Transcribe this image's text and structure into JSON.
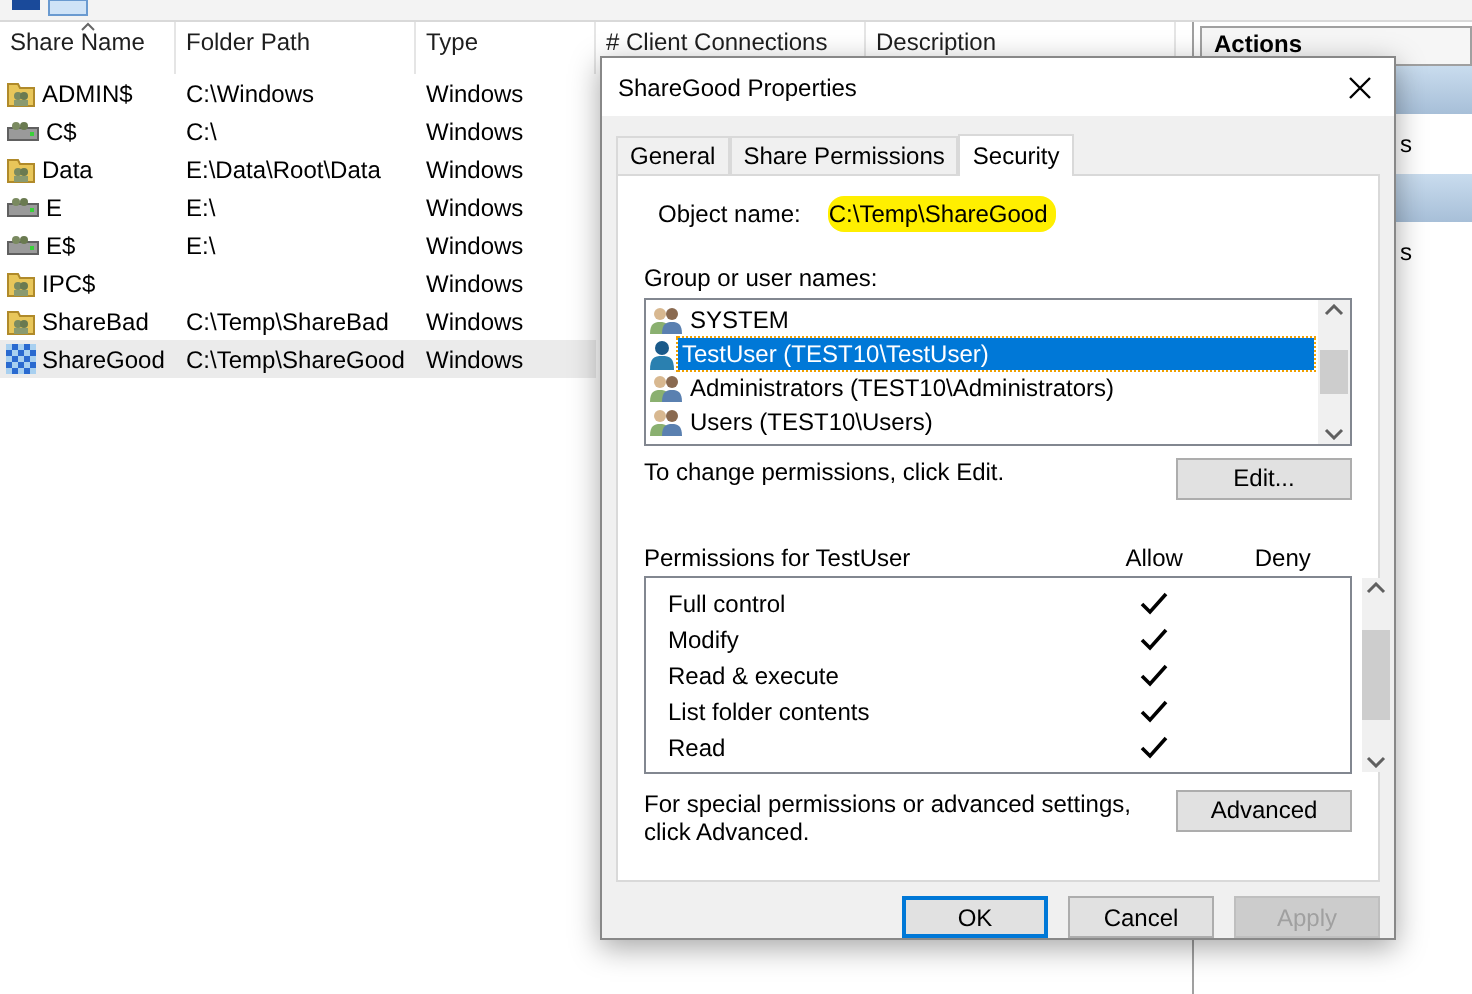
{
  "shares": {
    "columns": [
      {
        "label": "Share Name",
        "sorted": true
      },
      {
        "label": "Folder Path",
        "sorted": false
      },
      {
        "label": "Type",
        "sorted": false
      },
      {
        "label": "# Client Connections",
        "sorted": false
      },
      {
        "label": "Description",
        "sorted": false
      }
    ],
    "rows": [
      {
        "kind": "folder",
        "name": "ADMIN$",
        "path": "C:\\Windows",
        "type": "Windows",
        "selected": false
      },
      {
        "kind": "drive",
        "name": "C$",
        "path": "C:\\",
        "type": "Windows",
        "selected": false
      },
      {
        "kind": "folder",
        "name": "Data",
        "path": "E:\\Data\\Root\\Data",
        "type": "Windows",
        "selected": false
      },
      {
        "kind": "drive",
        "name": "E",
        "path": "E:\\",
        "type": "Windows",
        "selected": false
      },
      {
        "kind": "drive",
        "name": "E$",
        "path": "E:\\",
        "type": "Windows",
        "selected": false
      },
      {
        "kind": "folder",
        "name": "IPC$",
        "path": "",
        "type": "Windows",
        "selected": false
      },
      {
        "kind": "folder",
        "name": "ShareBad",
        "path": "C:\\Temp\\ShareBad",
        "type": "Windows",
        "selected": false
      },
      {
        "kind": "pattern",
        "name": "ShareGood",
        "path": "C:\\Temp\\ShareGood",
        "type": "Windows",
        "selected": true
      }
    ]
  },
  "actions": {
    "title": "Actions",
    "items": [
      {
        "kind": "header"
      },
      {
        "kind": "item",
        "label": "s"
      },
      {
        "kind": "header"
      },
      {
        "kind": "item",
        "label": "s"
      }
    ]
  },
  "dialog": {
    "title": "ShareGood Properties",
    "tabs": [
      {
        "label": "General",
        "selected": false
      },
      {
        "label": "Share Permissions",
        "selected": false
      },
      {
        "label": "Security",
        "selected": true
      }
    ],
    "object_name": {
      "label": "Object name:",
      "value": "C:\\Temp\\ShareGood",
      "highlighted": true
    },
    "groups_label": "Group or user names:",
    "groups": [
      {
        "kind": "group",
        "label": "SYSTEM",
        "selected": false
      },
      {
        "kind": "user",
        "label": "TestUser (TEST10\\TestUser)",
        "selected": true
      },
      {
        "kind": "group",
        "label": "Administrators (TEST10\\Administrators)",
        "selected": false
      },
      {
        "kind": "group",
        "label": "Users (TEST10\\Users)",
        "selected": false
      }
    ],
    "edit_hint": "To change permissions, click Edit.",
    "edit_button": "Edit...",
    "permissions_label": "Permissions for TestUser",
    "allow_label": "Allow",
    "deny_label": "Deny",
    "permissions": [
      {
        "label": "Full control",
        "allow": true,
        "deny": false
      },
      {
        "label": "Modify",
        "allow": true,
        "deny": false
      },
      {
        "label": "Read & execute",
        "allow": true,
        "deny": false
      },
      {
        "label": "List folder contents",
        "allow": true,
        "deny": false
      },
      {
        "label": "Read",
        "allow": true,
        "deny": false
      }
    ],
    "advanced_hint": "For special permissions or advanced settings, click Advanced.",
    "advanced_button": "Advanced",
    "buttons": [
      {
        "label": "OK",
        "kind": "default",
        "disabled": false
      },
      {
        "label": "Cancel",
        "kind": "normal",
        "disabled": false
      },
      {
        "label": "Apply",
        "kind": "normal",
        "disabled": true
      }
    ]
  }
}
